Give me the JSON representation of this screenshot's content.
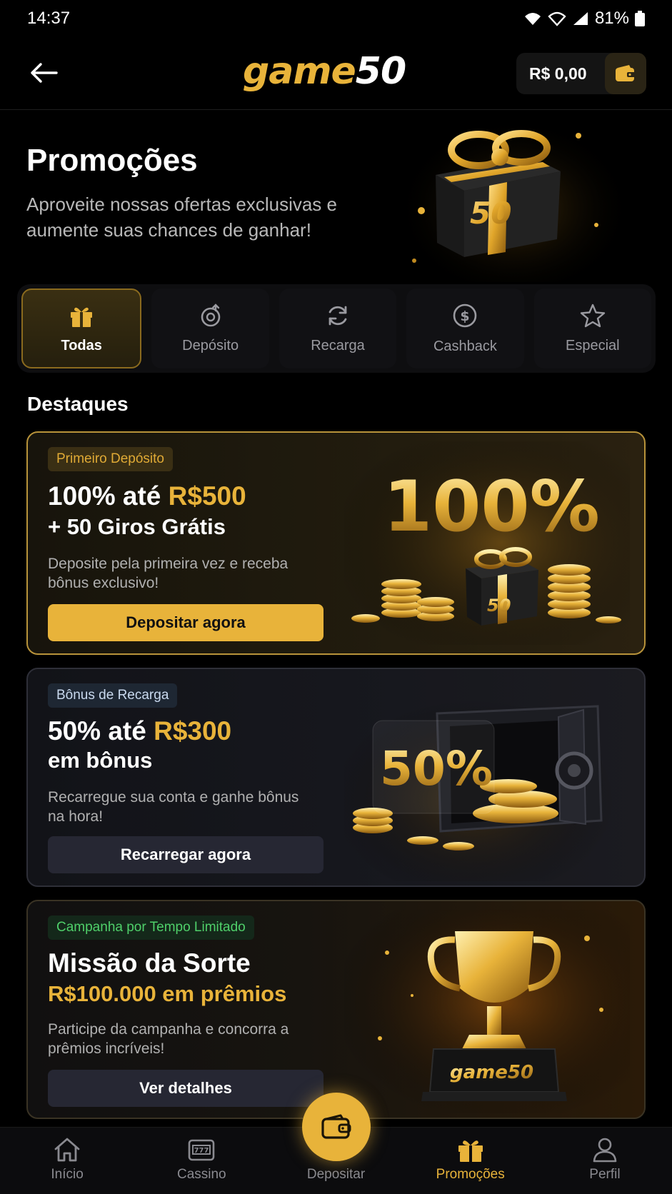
{
  "status_bar": {
    "time": "14:37",
    "battery": "81%"
  },
  "header": {
    "logo_game": "game",
    "logo_num": "50",
    "balance": "R$ 0,00"
  },
  "hero": {
    "title": "Promoções",
    "subtitle": "Aproveite nossas ofertas exclusivas e aumente suas chances de ganhar!",
    "gift_label": "50"
  },
  "tabs": [
    {
      "label": "Todas",
      "icon": "gift-icon",
      "active": true
    },
    {
      "label": "Depósito",
      "icon": "deposit-icon",
      "active": false
    },
    {
      "label": "Recarga",
      "icon": "refresh-icon",
      "active": false
    },
    {
      "label": "Cashback",
      "icon": "dollar-circle-icon",
      "active": false
    },
    {
      "label": "Especial",
      "icon": "star-icon",
      "active": false
    }
  ],
  "section_title": "Destaques",
  "promos": [
    {
      "badge": "Primeiro Depósito",
      "line1_a": "100% até ",
      "line1_b": "R$500",
      "line2": "+ 50 Giros Grátis",
      "desc": "Deposite pela primeira vez e receba bônus exclusivo!",
      "button": "Depositar agora",
      "art_text": "100%",
      "art_box": "50"
    },
    {
      "badge": "Bônus de Recarga",
      "line1_a": "50% até ",
      "line1_b": "R$300",
      "line2": "em bônus",
      "desc": "Recarregue sua conta e ganhe bônus na hora!",
      "button": "Recarregar agora",
      "art_text": "50%"
    },
    {
      "badge": "Campanha por Tempo Limitado",
      "line1": "Missão da Sorte",
      "line2": "R$100.000 em prêmios",
      "desc": "Participe da campanha e concorra a prêmios incríveis!",
      "button": "Ver detalhes",
      "art_text": "game50"
    }
  ],
  "bottom_nav": [
    {
      "label": "Início",
      "icon": "home-icon"
    },
    {
      "label": "Cassino",
      "icon": "slot-machine-icon"
    },
    {
      "label": "Depositar",
      "icon": "wallet-icon"
    },
    {
      "label": "Promoções",
      "icon": "gift-icon",
      "active": true
    },
    {
      "label": "Perfil",
      "icon": "user-icon"
    }
  ],
  "colors": {
    "accent": "#e8b33a",
    "background": "#000000"
  }
}
